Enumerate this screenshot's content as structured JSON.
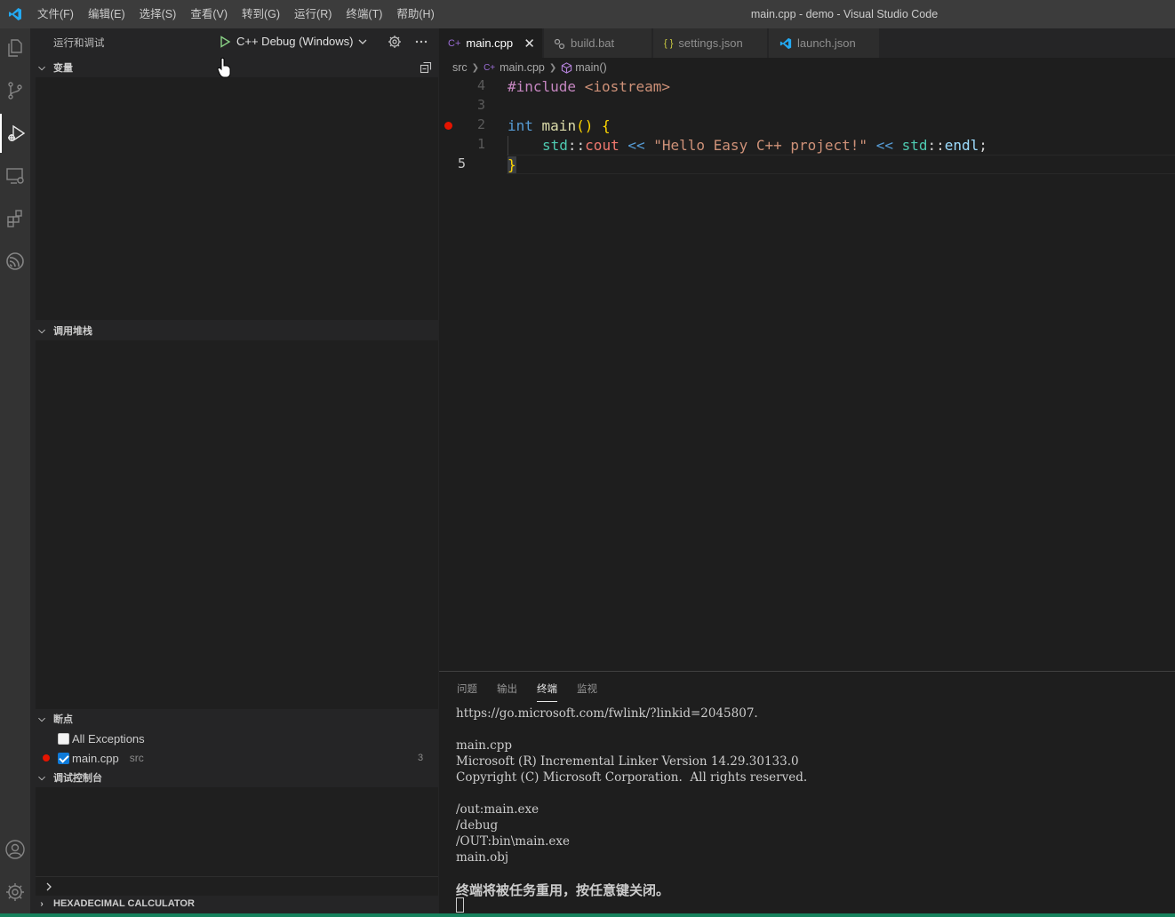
{
  "window": {
    "title": "main.cpp - demo - Visual Studio Code",
    "menu": [
      "文件(F)",
      "编辑(E)",
      "选择(S)",
      "查看(V)",
      "转到(G)",
      "运行(R)",
      "终端(T)",
      "帮助(H)"
    ]
  },
  "activity_bar": {
    "items": [
      "files-icon",
      "source-control-icon",
      "run-debug-icon",
      "remote-explorer-icon",
      "extensions-icon",
      "esp-idf-icon"
    ],
    "bottom": [
      "account-icon",
      "settings-gear-icon"
    ]
  },
  "sidebar": {
    "title": "运行和调试",
    "config_name": "C++ Debug (Windows)",
    "sections": {
      "variables": "变量",
      "callstack": "调用堆栈",
      "breakpoints": "断点",
      "debug_console": "调试控制台",
      "hex_calc": "HEXADECIMAL CALCULATOR"
    },
    "breakpoints": {
      "all_exceptions": "All Exceptions",
      "file": "main.cpp",
      "folder": "src",
      "line": "3"
    }
  },
  "tabs": [
    {
      "label": "main.cpp",
      "active": true
    },
    {
      "label": "build.bat",
      "active": false
    },
    {
      "label": "settings.json",
      "active": false
    },
    {
      "label": "launch.json",
      "active": false
    }
  ],
  "breadcrumb": {
    "folder": "src",
    "file": "main.cpp",
    "symbol": "main()"
  },
  "editor": {
    "line_numbers": [
      "4",
      "3",
      "2",
      "1",
      "5"
    ],
    "code": {
      "l1_directive": "#include",
      "l1_header": " <iostream>",
      "l3_type": "int",
      "l3_fn": " main",
      "l3_parens": "()",
      "l3_brace": " {",
      "l4_ns1": "std",
      "l4_scope1": "::",
      "l4_cout": "cout",
      "l4_op1": " << ",
      "l4_str": "\"Hello Easy C++ project!\"",
      "l4_op2": " << ",
      "l4_ns2": "std",
      "l4_scope2": "::",
      "l4_endl": "endl",
      "l4_semi": ";",
      "l5_brace": "}"
    }
  },
  "panel": {
    "tabs": [
      "问题",
      "输出",
      "终端",
      "监视"
    ],
    "active_tab": "终端",
    "terminal_lines": "https://go.microsoft.com/fwlink/?linkid=2045807.\n\nmain.cpp\nMicrosoft (R) Incremental Linker Version 14.29.30133.0\nCopyright (C) Microsoft Corporation.  All rights reserved.\n\n/out:main.exe\n/debug\n/OUT:bin\\main.exe\nmain.obj",
    "terminal_message": "终端将被任务重用，按任意键关闭。"
  },
  "colors": {
    "accent": "#007acc",
    "statusbar": "#16825d",
    "breakpoint": "#e51400",
    "run_green": "#89d185"
  }
}
